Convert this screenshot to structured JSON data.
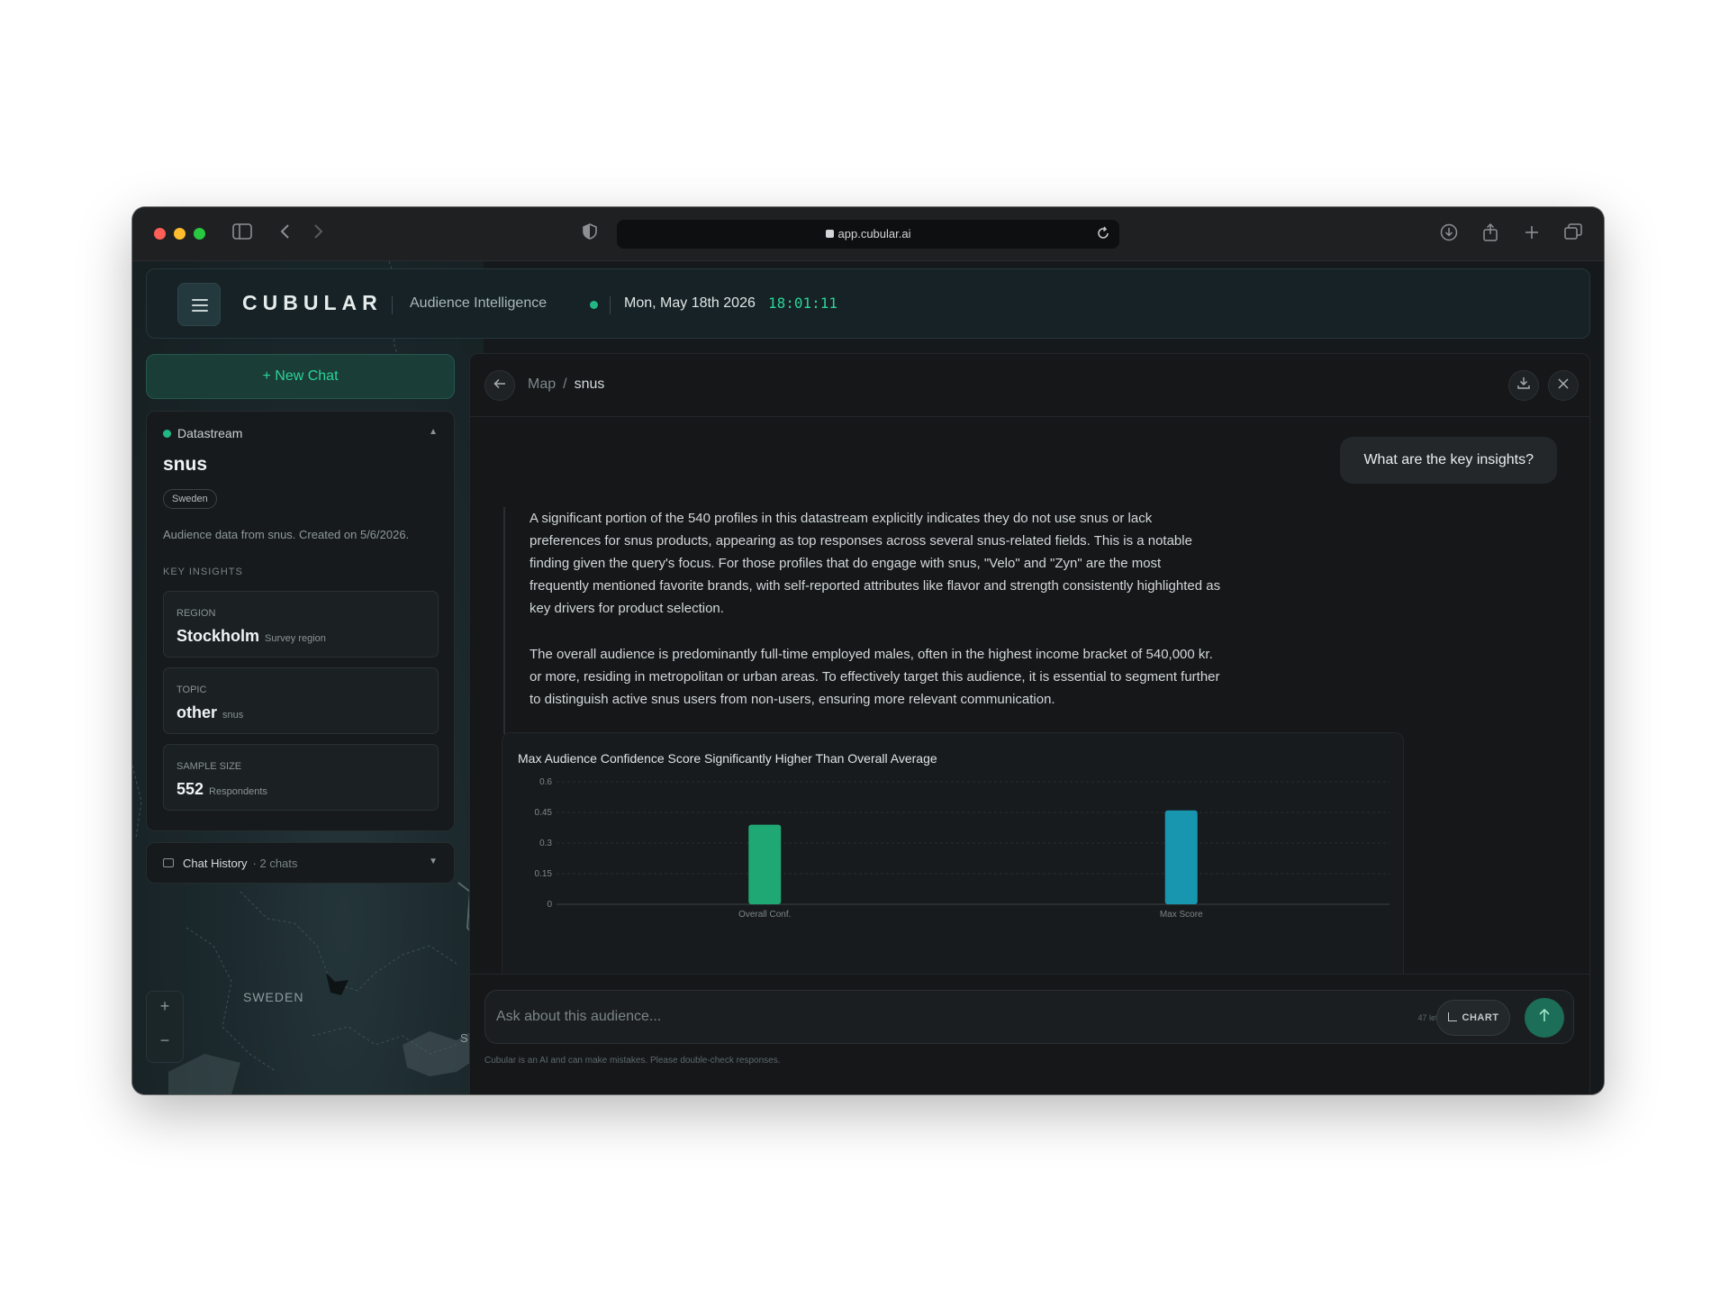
{
  "browser": {
    "url": "app.cubular.ai",
    "colors": {
      "close": "#ff5f57",
      "minimize": "#febc2e",
      "zoom": "#28c840"
    }
  },
  "header": {
    "logo": "CUBULAR",
    "subtitle": "Audience Intelligence",
    "date": "Mon, May 18th 2026",
    "time": "18:01:11",
    "accent": "#2bd497"
  },
  "sidebar": {
    "new_chat_label": "+ New Chat",
    "datastream_label": "Datastream",
    "datastream_name": "snus",
    "badge": "Sweden",
    "description": "Audience data from snus. Created on 5/6/2026.",
    "key_insights_label": "KEY INSIGHTS",
    "insights": [
      {
        "label": "REGION",
        "value": "Stockholm",
        "sub": "Survey region"
      },
      {
        "label": "TOPIC",
        "value": "other",
        "sub": "snus"
      },
      {
        "label": "SAMPLE SIZE",
        "value": "552",
        "sub": "Respondents"
      }
    ],
    "chat_history_label": "Chat History",
    "chat_history_count": "· 2 chats"
  },
  "map": {
    "country_label": "SWEDEN",
    "zoom_in": "+",
    "zoom_out": "−",
    "edge_label": "S"
  },
  "panel": {
    "breadcrumb_root": "Map",
    "breadcrumb_sep": "/",
    "breadcrumb_current": "snus",
    "question": "What are the key insights?",
    "paragraphs": [
      "A significant portion of the 540 profiles in this datastream explicitly indicates they do not use snus or lack preferences for snus products, appearing as top responses across several snus-related fields. This is a notable finding given the query's focus. For those profiles that do engage with snus, \"Velo\" and \"Zyn\" are the most frequently mentioned favorite brands, with self-reported attributes like flavor and strength consistently highlighted as key drivers for product selection.",
      "The overall audience is predominantly full-time employed males, often in the highest income bracket of 540,000 kr. or more, residing in metropolitan or urban areas. To effectively target this audience, it is essential to segment further to distinguish active snus users from non-users, ensuring more relevant communication."
    ],
    "input_placeholder": "Ask about this audience...",
    "chars_left": "47 left",
    "chart_button": "CHART",
    "disclaimer": "Cubular is an AI and can make mistakes. Please double-check responses."
  },
  "chart_data": {
    "type": "bar",
    "title": "Max Audience Confidence Score Significantly Higher Than Overall Average",
    "categories": [
      "Overall Conf.",
      "Max Score"
    ],
    "values": [
      0.39,
      0.46
    ],
    "colors": [
      "#1fa774",
      "#1896b0"
    ],
    "ylim": [
      0,
      0.6
    ],
    "yticks": [
      0,
      0.15,
      0.3,
      0.45,
      0.6
    ],
    "ytick_labels": [
      "0",
      "0.15",
      "0.3",
      "0.45",
      "0.6"
    ],
    "grid": true,
    "xlabel": "",
    "ylabel": ""
  }
}
